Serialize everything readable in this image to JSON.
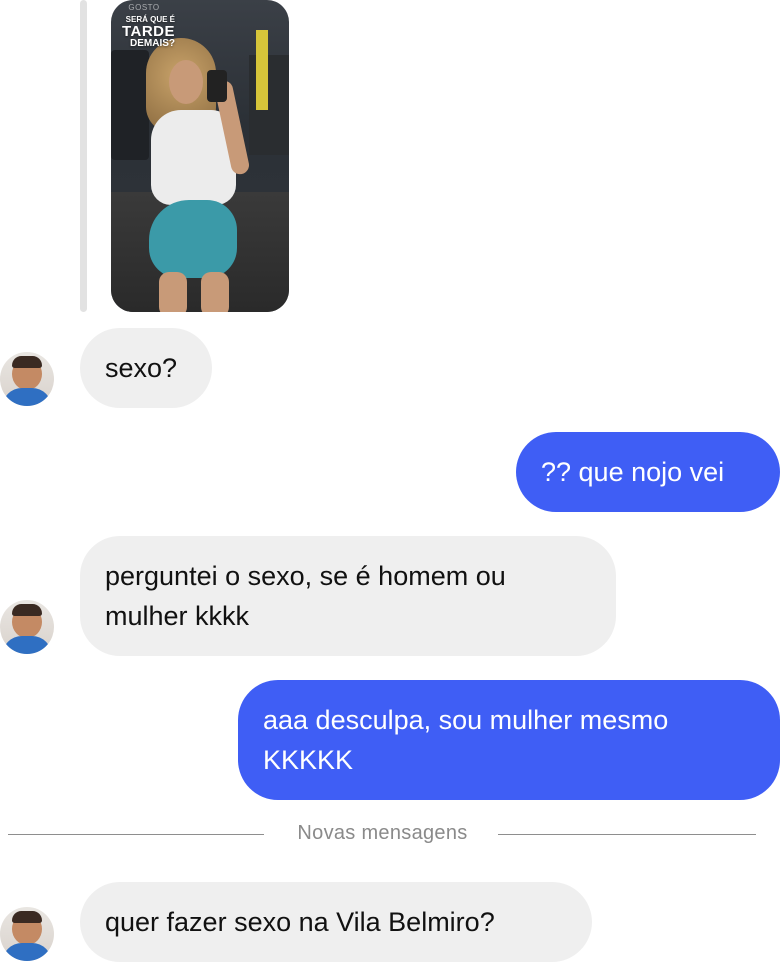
{
  "story": {
    "watermark": "GOSTO",
    "caption_line1": "SERÁ QUE É",
    "caption_line2": "TARDE",
    "caption_line3": "DEMAIS?"
  },
  "messages": [
    {
      "from": "them",
      "text": "sexo?"
    },
    {
      "from": "me",
      "text": "?? que nojo vei"
    },
    {
      "from": "them",
      "line1": "perguntei o sexo, se é homem ou",
      "line2": "mulher kkkk"
    },
    {
      "from": "me",
      "line1": "aaa desculpa, sou mulher mesmo",
      "line2": "KKKKK"
    },
    {
      "from": "them",
      "text": "quer fazer sexo na Vila Belmiro?"
    }
  ],
  "divider": {
    "label": "Novas mensagens"
  },
  "colors": {
    "outgoing_bubble": "#3f5ef5",
    "incoming_bubble": "#efefef",
    "divider": "#8e8e8e"
  },
  "icons": {
    "avatar": "contact-avatar"
  }
}
